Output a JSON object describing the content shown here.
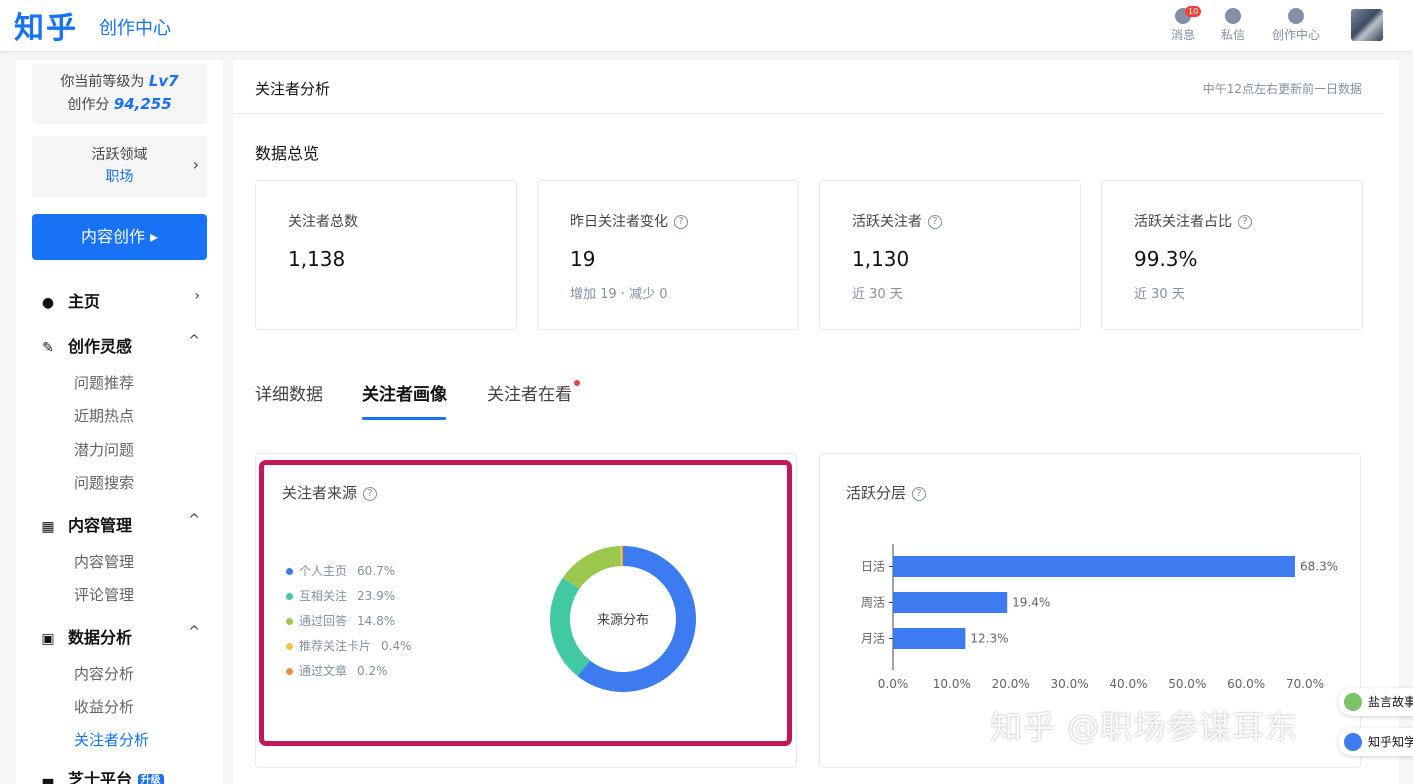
{
  "header": {
    "logo": "知乎",
    "subtitle": "创作中心",
    "icons": [
      {
        "label": "消息",
        "badge": "10",
        "icon": "bell-icon"
      },
      {
        "label": "私信",
        "icon": "chat-icon"
      },
      {
        "label": "创作中心",
        "icon": "user-edit-icon"
      }
    ]
  },
  "sidebar": {
    "level_text": "你当前等级为",
    "level_value": "Lv7",
    "score_text": "创作分",
    "score_value": "94,255",
    "area_label": "活跃领域",
    "area_value": "职场",
    "area_chevron": "›",
    "create_button": "内容创作 ▸",
    "nav": {
      "home": {
        "label": "主页",
        "arrow": "›"
      },
      "inspiration": {
        "label": "创作灵感",
        "arrow": "^",
        "items": [
          "问题推荐",
          "近期热点",
          "潜力问题",
          "问题搜索"
        ]
      },
      "content": {
        "label": "内容管理",
        "arrow": "^",
        "items": [
          "内容管理",
          "评论管理"
        ]
      },
      "analysis": {
        "label": "数据分析",
        "arrow": "^",
        "items": [
          "内容分析",
          "收益分析",
          "关注者分析"
        ]
      },
      "partial": {
        "label": "芝士平台",
        "tag": "升级"
      }
    }
  },
  "main": {
    "title": "关注者分析",
    "update_note": "中午12点左右更新前一日数据",
    "overview_title": "数据总览",
    "stats": [
      {
        "label": "关注者总数",
        "value": "1,138",
        "note": "",
        "help": false
      },
      {
        "label": "昨日关注者变化",
        "value": "19",
        "note": "增加 19 · 减少 0",
        "help": true
      },
      {
        "label": "活跃关注者",
        "value": "1,130",
        "note": "近 30 天",
        "help": true
      },
      {
        "label": "活跃关注者占比",
        "value": "99.3%",
        "note": "近 30 天",
        "help": true
      }
    ],
    "tabs": [
      "详细数据",
      "关注者画像",
      "关注者在看"
    ],
    "active_tab": "关注者画像"
  },
  "source_panel": {
    "title": "关注者来源",
    "center_label": "来源分布"
  },
  "activity_panel": {
    "title": "活跃分层"
  },
  "chart_data": [
    {
      "type": "pie",
      "categories": [
        "个人主页",
        "互相关注",
        "通过回答",
        "推荐关注卡片",
        "通过文章"
      ],
      "values": [
        60.7,
        23.9,
        14.8,
        0.4,
        0.2
      ],
      "labels": [
        "60.7%",
        "23.9%",
        "14.8%",
        "0.4%",
        "0.2%"
      ],
      "colors": [
        "#3d7cf0",
        "#41c9a3",
        "#9bc74d",
        "#f5c542",
        "#f08a4b"
      ],
      "legend": "left",
      "donut": true
    },
    {
      "type": "bar",
      "orientation": "horizontal",
      "categories": [
        "日活",
        "周活",
        "月活"
      ],
      "values": [
        68.3,
        19.4,
        12.3
      ],
      "labels": [
        "68.3%",
        "19.4%",
        "12.3%"
      ],
      "xlim": [
        0,
        70
      ],
      "ticks": [
        "0.0%",
        "10.0%",
        "20.0%",
        "30.0%",
        "40.0%",
        "50.0%",
        "60.0%",
        "70.0%"
      ],
      "color": "#3d7cf0"
    }
  ],
  "watermark": "知乎 @职场参谋耳东",
  "side_chips": [
    "盐言故事",
    "知乎知学堂"
  ]
}
